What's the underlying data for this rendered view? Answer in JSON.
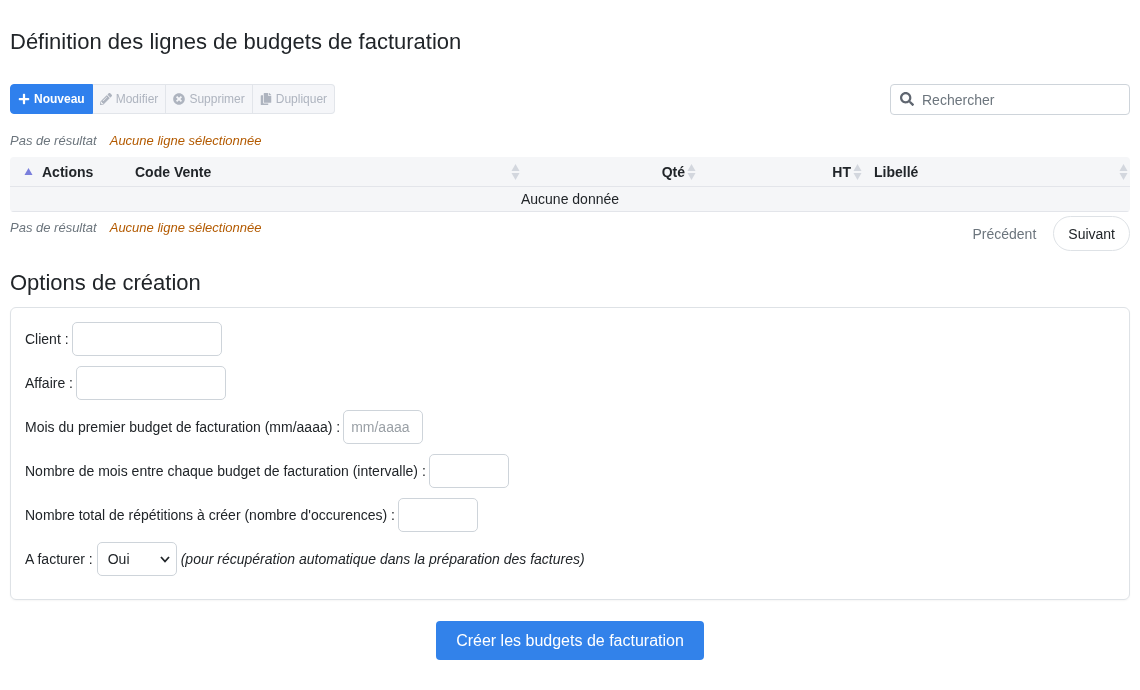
{
  "title": "Définition des lignes de budgets de facturation",
  "toolbar": {
    "buttons": [
      {
        "label": "Nouveau",
        "kind": "primary",
        "disabled": false
      },
      {
        "label": "Modifier",
        "kind": "default",
        "disabled": true
      },
      {
        "label": "Supprimer",
        "kind": "default",
        "disabled": true
      },
      {
        "label": "Dupliquer",
        "kind": "default",
        "disabled": true
      }
    ]
  },
  "search": {
    "placeholder": "Rechercher"
  },
  "status_top": {
    "result": "Pas de résultat",
    "selection": "Aucune ligne sélectionnée"
  },
  "table": {
    "columns": [
      {
        "label": "Actions",
        "kind": "actions",
        "sorted": true
      },
      {
        "label": "Code Vente",
        "kind": "text",
        "sorted": false
      },
      {
        "label": "Qté",
        "kind": "number",
        "sorted": false
      },
      {
        "label": "HT",
        "kind": "number",
        "sorted": false
      },
      {
        "label": "Libellé",
        "kind": "text",
        "sorted": false
      }
    ],
    "empty_message": "Aucune donnée"
  },
  "status_bottom": {
    "result": "Pas de résultat",
    "selection": "Aucune ligne sélectionnée"
  },
  "pagination": [
    {
      "label": "Précédent",
      "disabled": true
    },
    {
      "label": "Suivant",
      "disabled": false
    }
  ],
  "options": {
    "title": "Options de création",
    "fields": [
      {
        "kind": "text",
        "label": "Client :"
      },
      {
        "kind": "text",
        "label": "Affaire :"
      },
      {
        "kind": "month",
        "label": "Mois du premier budget de facturation (mm/aaaa) :",
        "placeholder": "mm/aaaa"
      },
      {
        "kind": "number",
        "label": "Nombre de mois entre chaque budget de facturation (intervalle) :"
      },
      {
        "kind": "number",
        "label": "Nombre total de répétitions à créer (nombre d'occurences) :"
      },
      {
        "kind": "select",
        "label": "A facturer :",
        "value": "Oui",
        "note": "(pour récupération automatique dans la préparation des factures)"
      }
    ]
  },
  "submit": {
    "label": "Créer les budgets de facturation"
  }
}
